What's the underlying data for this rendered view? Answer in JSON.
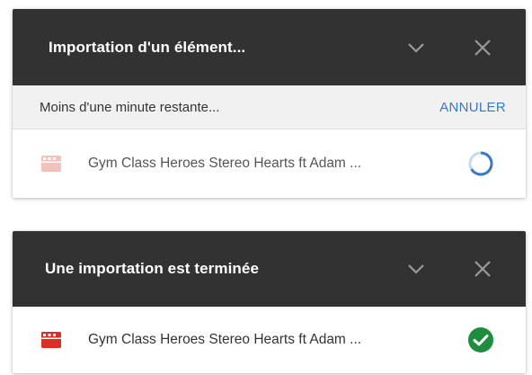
{
  "colors": {
    "header_bg": "#323232",
    "accent_blue": "#3b78c2",
    "success_green": "#1e8e3e",
    "video_red": "#d93025",
    "video_red_faded": "#f3c2bd"
  },
  "uploading_panel": {
    "title": "Importation d'un élément...",
    "header_icons": [
      "chevron-down-icon",
      "close-icon"
    ],
    "status_text": "Moins d'une minute restante...",
    "cancel_label": "ANNULER",
    "file": {
      "icon": "video-file-icon",
      "name": "Gym Class Heroes Stereo Hearts ft Adam ...",
      "status_icon": "progress-spinner-icon"
    }
  },
  "done_panel": {
    "title": "Une importation est terminée",
    "header_icons": [
      "chevron-down-icon",
      "close-icon"
    ],
    "file": {
      "icon": "video-file-icon",
      "name": "Gym Class Heroes Stereo Hearts ft Adam ...",
      "status_icon": "check-circle-icon"
    }
  }
}
